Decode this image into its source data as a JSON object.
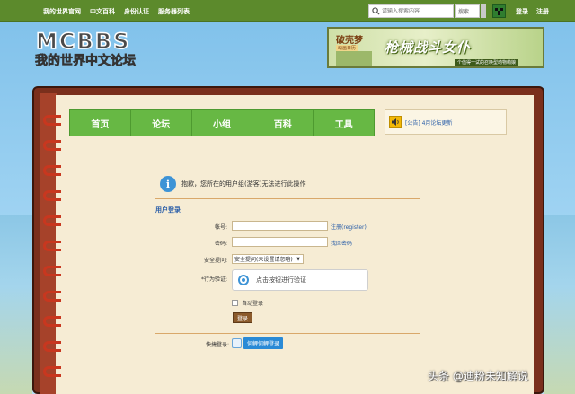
{
  "topbar": {
    "nav": [
      "我的世界官网",
      "中文百科",
      "身份认证",
      "服务器列表"
    ],
    "search_placeholder": "请输入搜索内容",
    "search_scope": "搜索",
    "login": "登录",
    "register": "注册"
  },
  "logo": {
    "text": "MCBBS",
    "subtitle": "我的世界中文论坛"
  },
  "banner": {
    "title": "破壳梦",
    "tag": "动画日历",
    "headline": "枪械战斗女仆",
    "caption": "个值得一试的召唤型动物萌娘"
  },
  "menu": [
    "首页",
    "论坛",
    "小组",
    "百科",
    "工具"
  ],
  "notice": "[公告] 4月论坛更新",
  "alert": "抱歉，您所在的用户组(游客)无法进行此操作",
  "login_form": {
    "title": "用户登录",
    "account_label": "帐号:",
    "register_link": "注册(register)",
    "password_label": "密码:",
    "forgot_link": "找回密码",
    "question_label": "安全提问:",
    "question_value": "安全提问(未设置请忽略)",
    "captcha_label": "*行为验证:",
    "captcha_text": "点击按钮进行验证",
    "remember": "自动登录",
    "submit": "登录",
    "quick_label": "快捷登录:",
    "quick_button": "何鲤何鲤登录"
  },
  "watermark": "头条 @迪粉未知解说",
  "colors": {
    "topbar": "#5c8a2c",
    "menu": "#67b844",
    "link": "#2a5ea8",
    "page": "#f6ecd4",
    "book": "#7a2f1c"
  }
}
